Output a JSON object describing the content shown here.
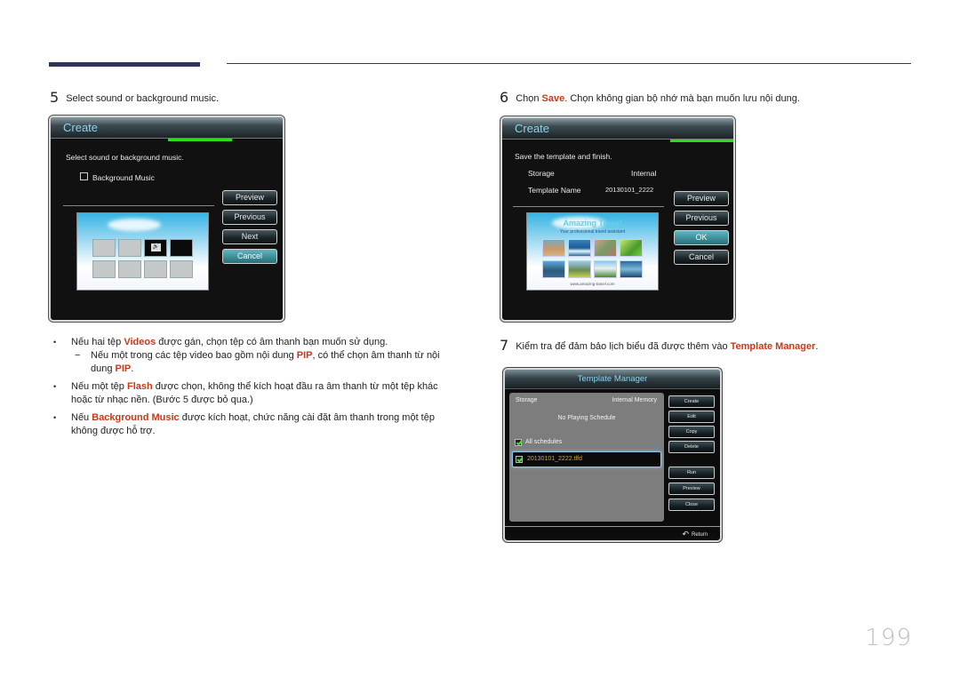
{
  "step5": {
    "number": "5",
    "text": "Select sound or background music."
  },
  "panel1": {
    "title": "Create",
    "instruction": "Select sound or background music.",
    "checkbox_label": "Background Music",
    "checkbox_checked": false,
    "buttons": [
      "Preview",
      "Previous",
      "Next",
      "Cancel"
    ],
    "active_button": "Cancel",
    "thumbnail_icon": "sound-icon"
  },
  "step6": {
    "number": "6",
    "prefix": "Chọn ",
    "highlight": "Save",
    "suffix": ". Chọn không gian bộ nhớ mà bạn muốn lưu nội dung."
  },
  "panel2": {
    "title": "Create",
    "instruction": "Save the template and finish.",
    "storage_label": "Storage",
    "storage_value": "Internal",
    "name_label": "Template Name",
    "name_value": "20130101_2222",
    "buttons": [
      "Preview",
      "Previous",
      "OK",
      "Cancel"
    ],
    "active_button": "OK",
    "preview": {
      "title": "Amazing Travel",
      "subtitle": "Your professional travel assistant",
      "url": "www.amazing-travel.com"
    }
  },
  "bullets": [
    {
      "parts": [
        {
          "t": "Nếu hai tệp ",
          "h": false
        },
        {
          "t": "Videos",
          "h": true
        },
        {
          "t": " được gán, chọn tệp có âm thanh bạn muốn sử dụng.",
          "h": false
        }
      ],
      "sub": [
        {
          "t": "Nếu một trong các tệp video bao gồm nội dung ",
          "h": false
        },
        {
          "t": "PIP",
          "h": true
        },
        {
          "t": ", có thể chọn âm thanh từ nội dung ",
          "h": false
        },
        {
          "t": "PIP",
          "h": true
        },
        {
          "t": ".",
          "h": false
        }
      ]
    },
    {
      "parts": [
        {
          "t": "Nếu một tệp ",
          "h": false
        },
        {
          "t": "Flash",
          "h": true
        },
        {
          "t": " được chọn, không thể kích hoạt đầu ra âm thanh từ một tệp khác hoặc từ nhạc nền. (Bước 5 được bỏ qua.)",
          "h": false
        }
      ]
    },
    {
      "parts": [
        {
          "t": "Nếu ",
          "h": false
        },
        {
          "t": "Background Music",
          "h": true
        },
        {
          "t": " được kích hoạt, chức năng cài đặt âm thanh trong một tệp không được hỗ trợ.",
          "h": false
        }
      ]
    }
  ],
  "step7": {
    "number": "7",
    "prefix": "Kiểm tra để đảm bảo lịch biểu đã được thêm vào ",
    "highlight": "Template Manager",
    "suffix": "."
  },
  "template_manager": {
    "title": "Template Manager",
    "storage_label": "Storage",
    "storage_value": "Internal Memory",
    "status": "No Playing Schedule",
    "all_schedules_label": "All schedules",
    "all_schedules_checked": true,
    "schedule_item": "20130101_2222.tlfd",
    "schedule_item_checked": true,
    "buttons": [
      "Create",
      "Edit",
      "Copy",
      "Delete",
      "Run",
      "Preview",
      "Close"
    ],
    "return_label": "Return"
  },
  "page_number": "199",
  "colors": {
    "highlight": "#c8381a",
    "accent_green": "#2ddc1f",
    "title_blue": "#8fd3ee",
    "header_bar": "#2e3557"
  }
}
